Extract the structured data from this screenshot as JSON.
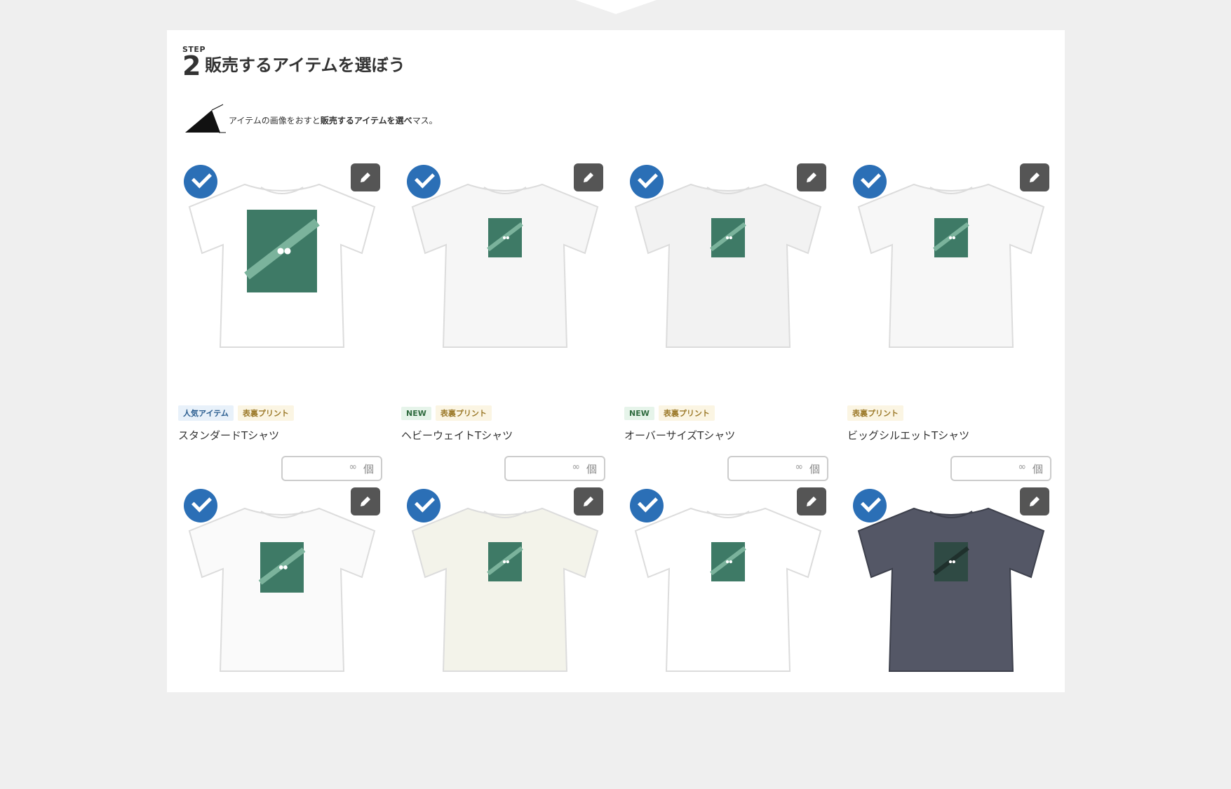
{
  "step": {
    "label": "STEP",
    "number": "2",
    "title": "販売するアイテムを選ぼう"
  },
  "hint": {
    "prefix": "アイテムの画像をおすと",
    "emphasis": "販売するアイテムを選べ",
    "suffix": "マス。"
  },
  "colors": {
    "check": "#2b6fb6",
    "edit_button": "#555555",
    "panel": "#ffffff",
    "background": "#efefef"
  },
  "items": [
    {
      "name": "スタンダードTシャツ",
      "badges": [
        {
          "text": "人気アイテム",
          "kind": "pop"
        },
        {
          "text": "表裏プリント",
          "kind": "ura"
        }
      ],
      "shirt_color": "#ffffff",
      "print": "large",
      "selected": true,
      "qty_placeholder": "",
      "qty_infinite": "∞",
      "qty_unit": "個",
      "edit_icon": "pencil-icon"
    },
    {
      "name": "ヘビーウェイトTシャツ",
      "badges": [
        {
          "text": "NEW",
          "kind": "new"
        },
        {
          "text": "表裏プリント",
          "kind": "ura"
        }
      ],
      "shirt_color": "#f6f6f6",
      "print": "small",
      "selected": true,
      "qty_placeholder": "",
      "qty_infinite": "∞",
      "qty_unit": "個",
      "edit_icon": "pencil-icon"
    },
    {
      "name": "オーバーサイズTシャツ",
      "badges": [
        {
          "text": "NEW",
          "kind": "new"
        },
        {
          "text": "表裏プリント",
          "kind": "ura"
        }
      ],
      "shirt_color": "#f2f2f2",
      "print": "small",
      "selected": true,
      "qty_placeholder": "",
      "qty_infinite": "∞",
      "qty_unit": "個",
      "edit_icon": "pencil-icon"
    },
    {
      "name": "ビッグシルエットTシャツ",
      "badges": [
        {
          "text": "表裏プリント",
          "kind": "ura"
        }
      ],
      "shirt_color": "#f7f7f7",
      "print": "small",
      "selected": true,
      "qty_placeholder": "",
      "qty_infinite": "∞",
      "qty_unit": "個",
      "edit_icon": "pencil-icon"
    },
    {
      "name": "",
      "badges": [],
      "shirt_color": "#fafafa",
      "print": "medium",
      "selected": true,
      "edit_icon": "pencil-icon"
    },
    {
      "name": "",
      "badges": [],
      "shirt_color": "#f3f3ea",
      "print": "small",
      "selected": true,
      "edit_icon": "pencil-icon"
    },
    {
      "name": "",
      "badges": [],
      "shirt_color": "#ffffff",
      "print": "small",
      "selected": true,
      "edit_icon": "pencil-icon"
    },
    {
      "name": "",
      "badges": [],
      "shirt_color": "#545766",
      "print": "small-dark",
      "selected": true,
      "edit_icon": "pencil-icon"
    }
  ]
}
